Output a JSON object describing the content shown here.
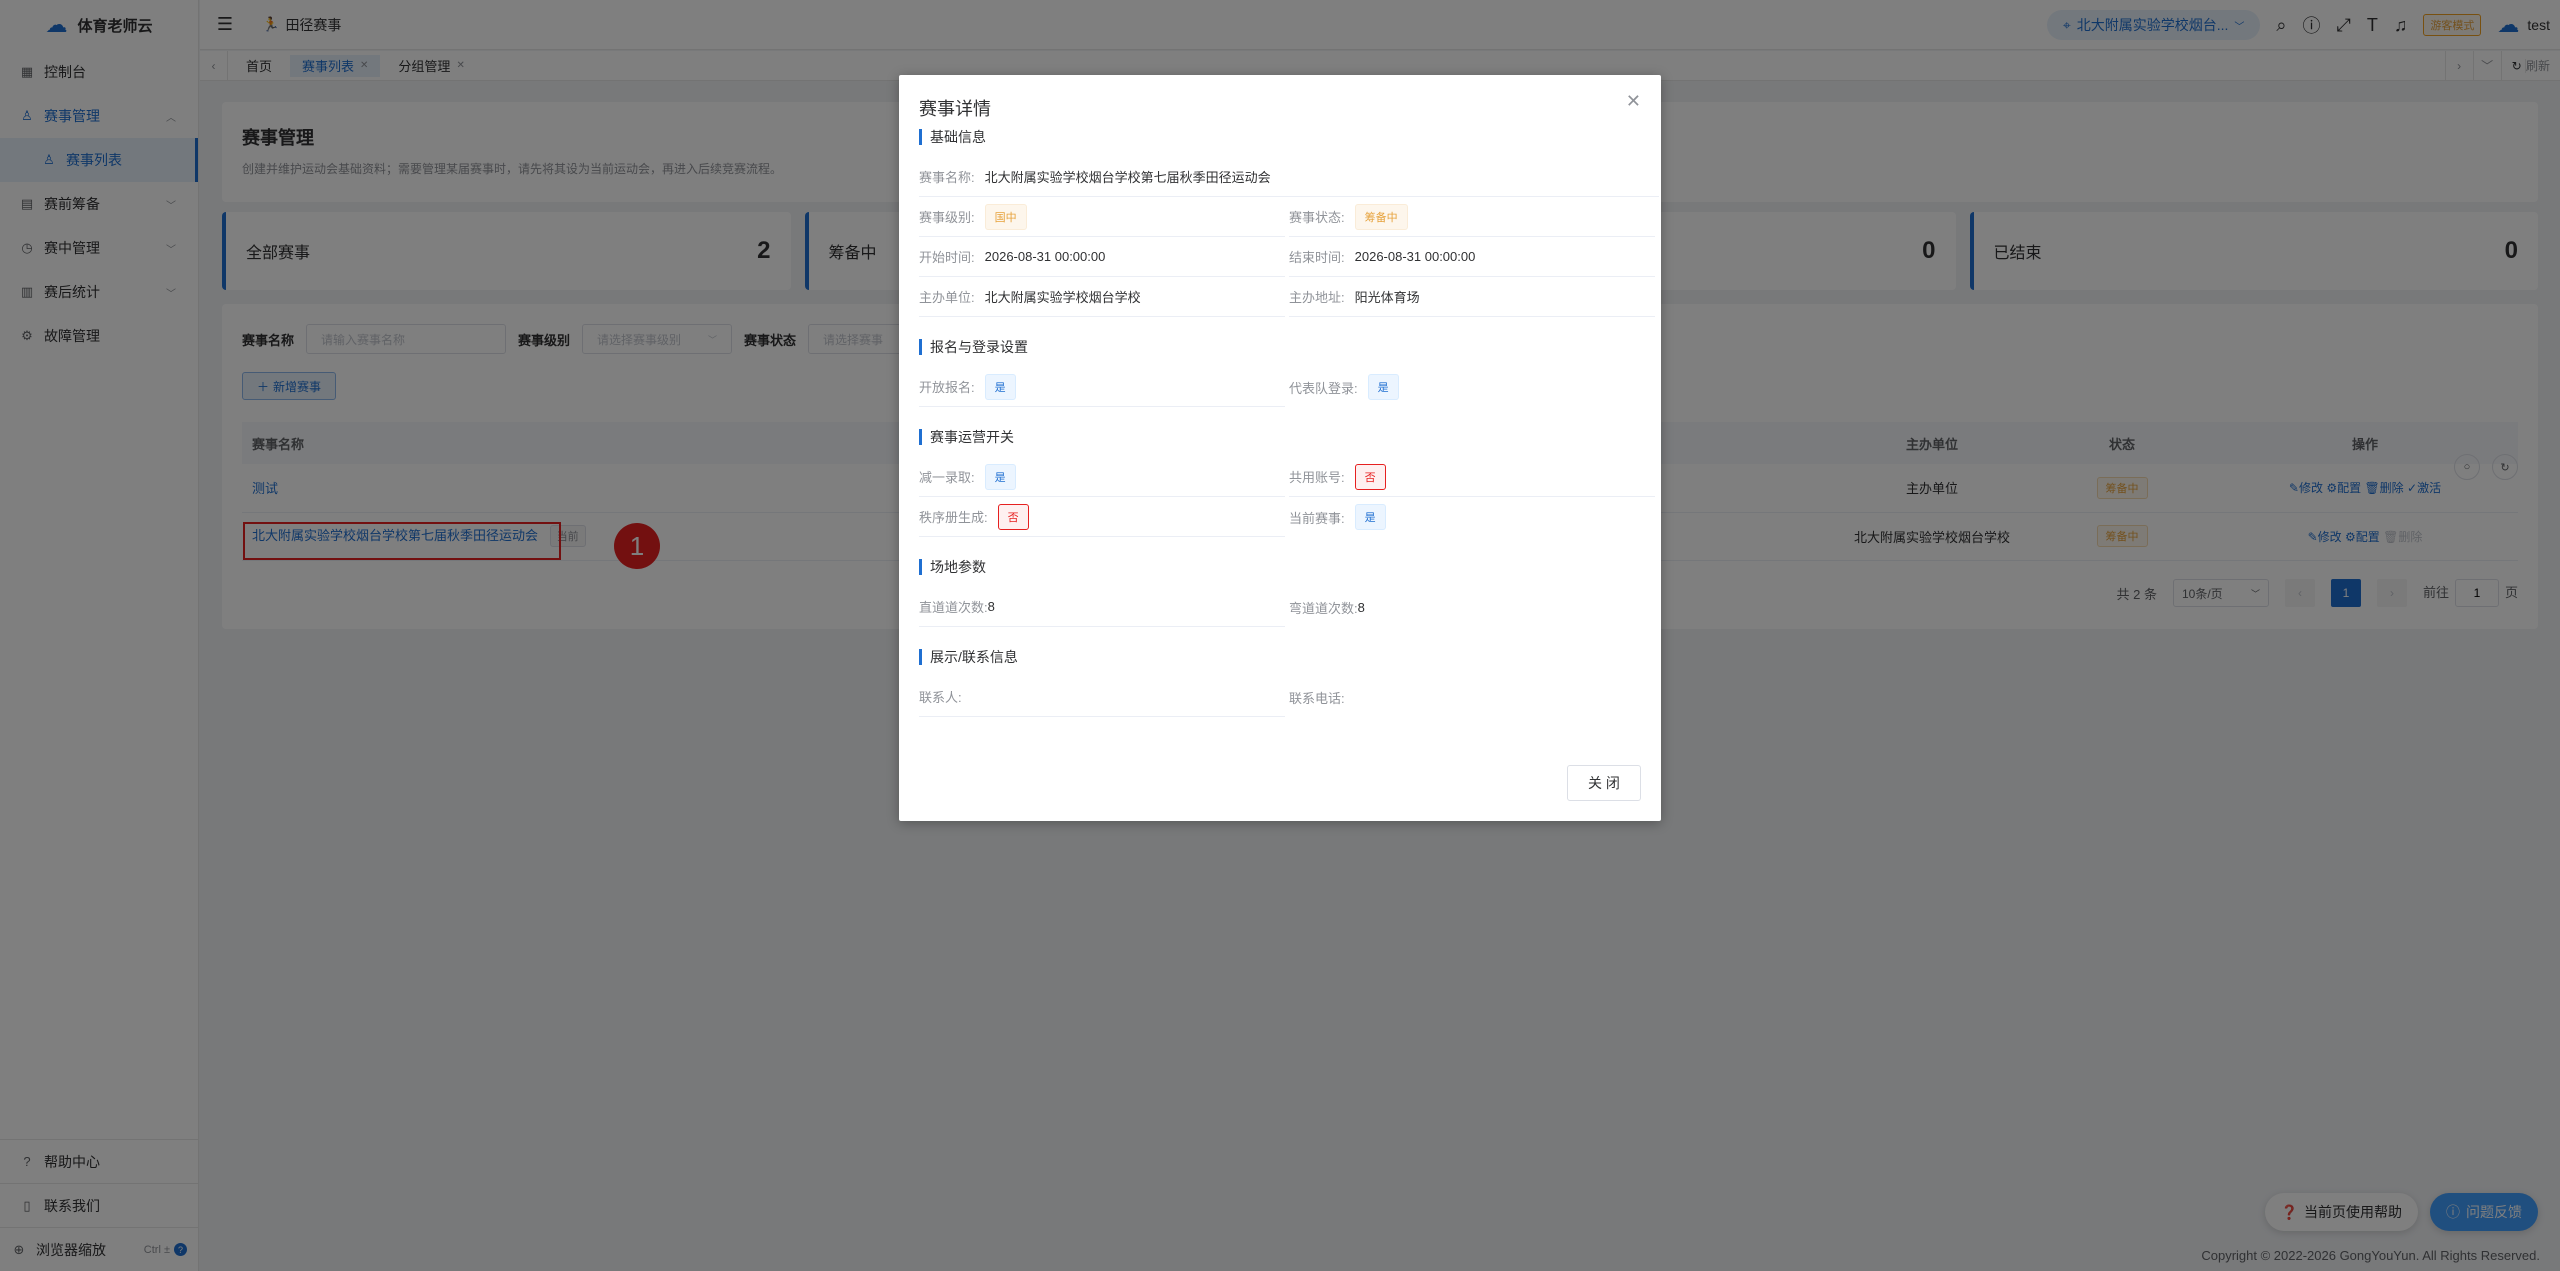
{
  "app": {
    "name": "体育老师云"
  },
  "sidebar": {
    "items": [
      {
        "label": "控制台",
        "icon": "dashboard-icon"
      },
      {
        "label": "赛事管理",
        "icon": "trophy-icon"
      },
      {
        "label": "赛事列表",
        "icon": "trophy-icon"
      },
      {
        "label": "赛前筹备",
        "icon": "clipboard-icon"
      },
      {
        "label": "赛中管理",
        "icon": "clock-icon"
      },
      {
        "label": "赛后统计",
        "icon": "chart-icon"
      },
      {
        "label": "故障管理",
        "icon": "wrench-icon"
      }
    ],
    "bottom": [
      {
        "label": "帮助中心"
      },
      {
        "label": "联系我们"
      },
      {
        "label": "浏览器缩放",
        "shortcut": "Ctrl ±"
      }
    ]
  },
  "topbar": {
    "breadcrumb": "田径赛事",
    "school": "北大附属实验学校烟台...",
    "guest_mode": "游客模式",
    "user": "test"
  },
  "tabs": [
    {
      "label": "首页"
    },
    {
      "label": "赛事列表"
    },
    {
      "label": "分组管理"
    }
  ],
  "tabs_refresh": "刷新",
  "page": {
    "title": "赛事管理",
    "subtitle": "创建并维护运动会基础资料；需要管理某届赛事时，请先将其设为当前运动会，再进入后续竞赛流程。"
  },
  "stats": [
    {
      "label": "全部赛事",
      "value": "2"
    },
    {
      "label": "筹备中",
      "value": ""
    },
    {
      "label": "",
      "value": "0"
    },
    {
      "label": "已结束",
      "value": "0"
    }
  ],
  "filters": {
    "name_label": "赛事名称",
    "name_placeholder": "请输入赛事名称",
    "level_label": "赛事级别",
    "level_placeholder": "请选择赛事级别",
    "status_label": "赛事状态",
    "status_placeholder": "请选择赛事"
  },
  "add_button": "新增赛事",
  "table": {
    "headers": {
      "name": "赛事名称",
      "organizer": "主办单位",
      "status": "状态",
      "ops": "操作"
    },
    "rows": [
      {
        "name": "测试",
        "tag": "",
        "organizer": "主办单位",
        "status": "筹备中",
        "ops": [
          "修改",
          "配置",
          "删除",
          "激活"
        ]
      },
      {
        "name": "北大附属实验学校烟台学校第七届秋季田径运动会",
        "tag": "当前",
        "organizer": "北大附属实验学校烟台学校",
        "status": "筹备中",
        "ops": [
          "修改",
          "配置",
          "删除"
        ]
      }
    ]
  },
  "pager": {
    "total": "共 2 条",
    "size": "10条/页",
    "page": "1",
    "goto": "前往",
    "goto_value": "1",
    "unit": "页"
  },
  "annotation_marker": "1",
  "footer": {
    "copyright": "Copyright © 2022-2026 GongYouYun. All Rights Reserved.",
    "help_current": "当前页使用帮助",
    "feedback": "问题反馈"
  },
  "modal": {
    "title": "赛事详情",
    "close_label": "关 闭",
    "sections": {
      "basic": "基础信息",
      "signup": "报名与登录设置",
      "ops_switch": "赛事运营开关",
      "venue": "场地参数",
      "contact": "展示/联系信息"
    },
    "fields": {
      "name_k": "赛事名称:",
      "name_v": "北大附属实验学校烟台学校第七届秋季田径运动会",
      "level_k": "赛事级别:",
      "level_v": "国中",
      "status_k": "赛事状态:",
      "status_v": "筹备中",
      "start_k": "开始时间:",
      "start_v": "2026-08-31 00:00:00",
      "end_k": "结束时间:",
      "end_v": "2026-08-31 00:00:00",
      "org_k": "主办单位:",
      "org_v": "北大附属实验学校烟台学校",
      "addr_k": "主办地址:",
      "addr_v": "阳光体育场",
      "open_k": "开放报名:",
      "open_v": "是",
      "team_k": "代表队登录:",
      "team_v": "是",
      "reduce_k": "减一录取:",
      "reduce_v": "是",
      "share_k": "共用账号:",
      "share_v": "否",
      "order_k": "秩序册生成:",
      "order_v": "否",
      "current_k": "当前赛事:",
      "current_v": "是",
      "straight_k": "直道道次数:",
      "straight_v": "8",
      "curve_k": "弯道道次数:",
      "curve_v": "8",
      "contact_k": "联系人:",
      "phone_k": "联系电话:"
    }
  }
}
